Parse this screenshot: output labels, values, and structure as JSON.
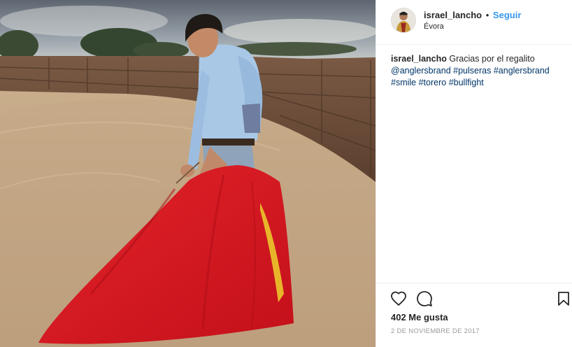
{
  "post": {
    "username": "israel_lancho",
    "separator": "•",
    "follow_label": "Seguir",
    "location": "Évora",
    "caption": {
      "username": "israel_lancho",
      "text": "Gracias por el regalito",
      "tags": [
        "@anglersbrand",
        "#pulseras",
        "#anglersbrand",
        "#smile",
        "#torero",
        "#bullfight"
      ]
    },
    "likes": "402 Me gusta",
    "date": "2 DE NOVIEMBRE DE 2017"
  },
  "icons": {
    "like": "heart-icon",
    "comment": "comment-icon",
    "save": "bookmark-icon"
  },
  "colors": {
    "follow": "#3897f0",
    "hashtag": "#003569",
    "cape_red": "#d6151d",
    "cape_yellow": "#e8b52a"
  }
}
